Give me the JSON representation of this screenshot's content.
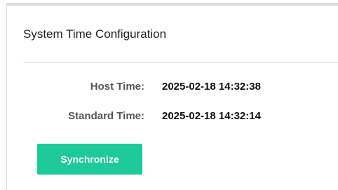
{
  "panel": {
    "title": "System Time Configuration"
  },
  "rows": [
    {
      "label": "Host Time:",
      "value": "2025-02-18 14:32:38"
    },
    {
      "label": "Standard Time:",
      "value": "2025-02-18 14:32:14"
    }
  ],
  "actions": {
    "sync_label": "Synchronize"
  },
  "colors": {
    "accent": "#1ec99a",
    "border": "#dcdcdc"
  }
}
